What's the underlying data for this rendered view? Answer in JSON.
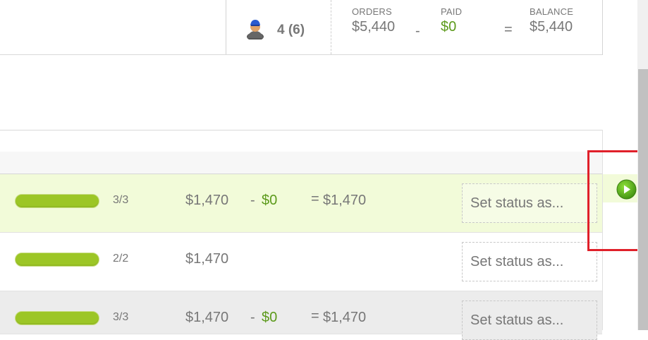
{
  "header": {
    "people_count": "4 (6)",
    "orders_label": "ORDERS",
    "orders_value": "$5,440",
    "paid_label": "PAID",
    "paid_value": "$0",
    "balance_label": "BALANCE",
    "balance_value": "$5,440",
    "minus_op": "-",
    "equals_op": "="
  },
  "rows": [
    {
      "progress": 1.0,
      "fraction": "3/3",
      "amount": "$1,470",
      "minus": "-",
      "paid": "$0",
      "equals": "=",
      "balance": "$1,470",
      "status_placeholder": "Set status as..."
    },
    {
      "progress": 1.0,
      "fraction": "2/2",
      "amount": "$1,470",
      "minus": "",
      "paid": "",
      "equals": "",
      "balance": "",
      "status_placeholder": "Set status as..."
    },
    {
      "progress": 1.0,
      "fraction": "3/3",
      "amount": "$1,470",
      "minus": "-",
      "paid": "$0",
      "equals": "=",
      "balance": "$1,470",
      "status_placeholder": "Set status as..."
    }
  ],
  "icons": {
    "avatar": "person-avatar-icon",
    "play": "play-icon"
  },
  "colors": {
    "paid_green": "#5c9a1b",
    "progress_green": "#9cc626",
    "selected_row": "#f2fbd9",
    "highlight_red": "#e0202a"
  }
}
